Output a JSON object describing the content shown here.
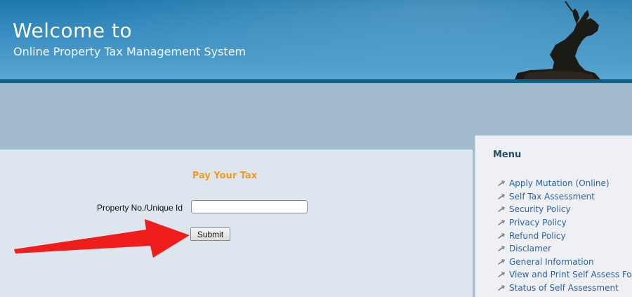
{
  "header": {
    "welcome": "Welcome to",
    "subtitle": "Online Property Tax Management System"
  },
  "form": {
    "title": "Pay Your Tax",
    "property_label": "Property No./Unique Id",
    "property_value": "",
    "submit_label": "Submit"
  },
  "menu": {
    "title": "Menu",
    "items": [
      {
        "label": "Apply Mutation (Online)"
      },
      {
        "label": "Self Tax Assessment"
      },
      {
        "label": "Security Policy"
      },
      {
        "label": "Privacy Policy"
      },
      {
        "label": "Refund Policy"
      },
      {
        "label": "Disclamer"
      },
      {
        "label": "General Information"
      },
      {
        "label": "View and Print Self Assess Form"
      },
      {
        "label": "Status of Self Assessment"
      }
    ]
  },
  "colors": {
    "header": "#2f86bb",
    "accent": "#f29a1d",
    "link": "#2c62a8",
    "arrow": "#f01d1d"
  }
}
